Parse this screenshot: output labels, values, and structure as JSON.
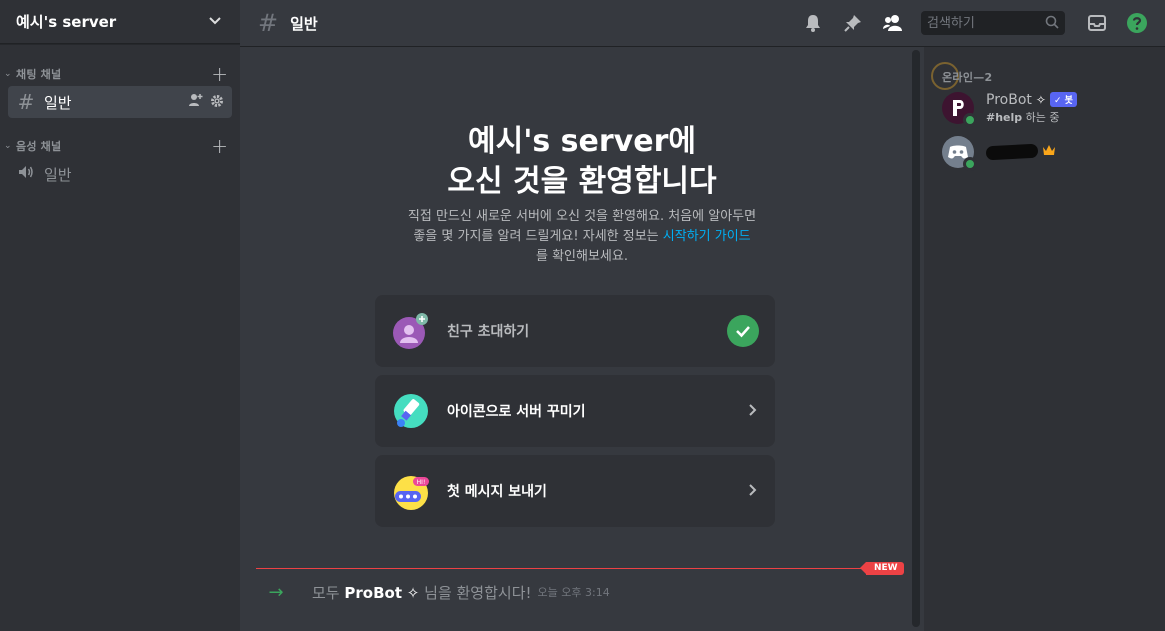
{
  "server": {
    "name": "예시's server"
  },
  "sidebar": {
    "text_category": "채팅 채널",
    "voice_category": "음성 채널",
    "text_channel": "일반",
    "voice_channel": "일반"
  },
  "topbar": {
    "channel_name": "일반",
    "search_placeholder": "검색하기"
  },
  "welcome": {
    "title_line1": "예시's server에",
    "title_line2": "오신 것을 환영합니다",
    "desc_line1": "직접 만드신 새로운 서버에 오신 것을 환영해요. 처음에 알아두면",
    "desc_line2": "좋을 몇 가지를 알려   드릴게요! 자세한 정보는",
    "desc_link": "시작하기 가이드",
    "desc_line3": "를 확인해보세요."
  },
  "cards": [
    {
      "label": "친구 초대하기",
      "done": true
    },
    {
      "label": "아이콘으로 서버 꾸미기",
      "done": false
    },
    {
      "label": "첫 메시지 보내기",
      "done": false
    }
  ],
  "new_badge": "NEW",
  "join_message": {
    "prefix": "모두",
    "user": "ProBot",
    "suffix": "님을 환영합시다!",
    "time": "오늘 오후 3:14"
  },
  "members": {
    "header": "온라인—2",
    "list": [
      {
        "name": "ProBot",
        "tag": "✓ 봇",
        "activity_bold": "#help",
        "activity": "하는 중"
      }
    ]
  },
  "colors": {
    "accent": "#5865f2",
    "online": "#3ba55d",
    "new_red": "#ed4245",
    "link": "#00aff4"
  }
}
